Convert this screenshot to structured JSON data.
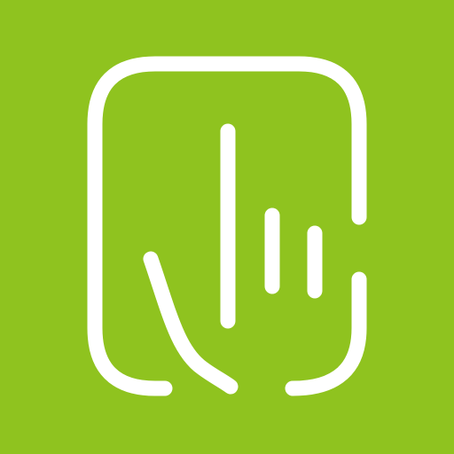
{
  "app_icon": {
    "icon_name": "hand-touch-tablet-icon",
    "background_color": "#8fc31f",
    "stroke_color": "#ffffff"
  }
}
